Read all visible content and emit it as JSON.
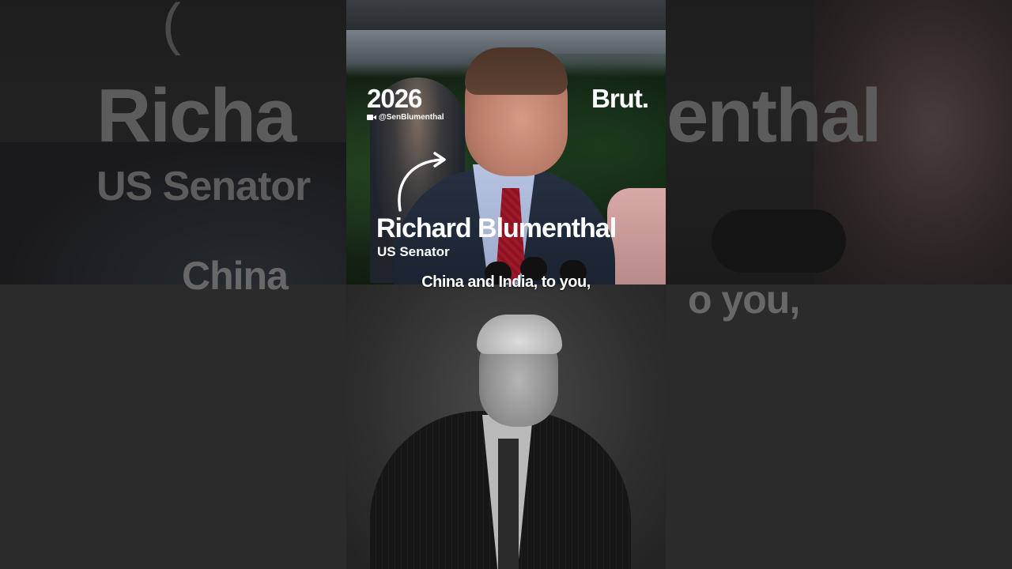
{
  "overlay": {
    "year": "2026",
    "handle": "@SenBlumenthal",
    "handle_icon": "video-camera-icon",
    "brand": "Brut.",
    "name": "Richard Blumenthal",
    "role": "US Senator",
    "subtitle": "China and India, to you,"
  },
  "background_echo": {
    "paren": "(",
    "name_left": "Richa",
    "name_right": "enthal",
    "role_left": "US Senator",
    "subtitle_left": "China",
    "subtitle_right": "o you,"
  },
  "colors": {
    "overlay_text": "#ffffff",
    "background_text": "#5c5c5c",
    "tie": "#a0192a"
  }
}
